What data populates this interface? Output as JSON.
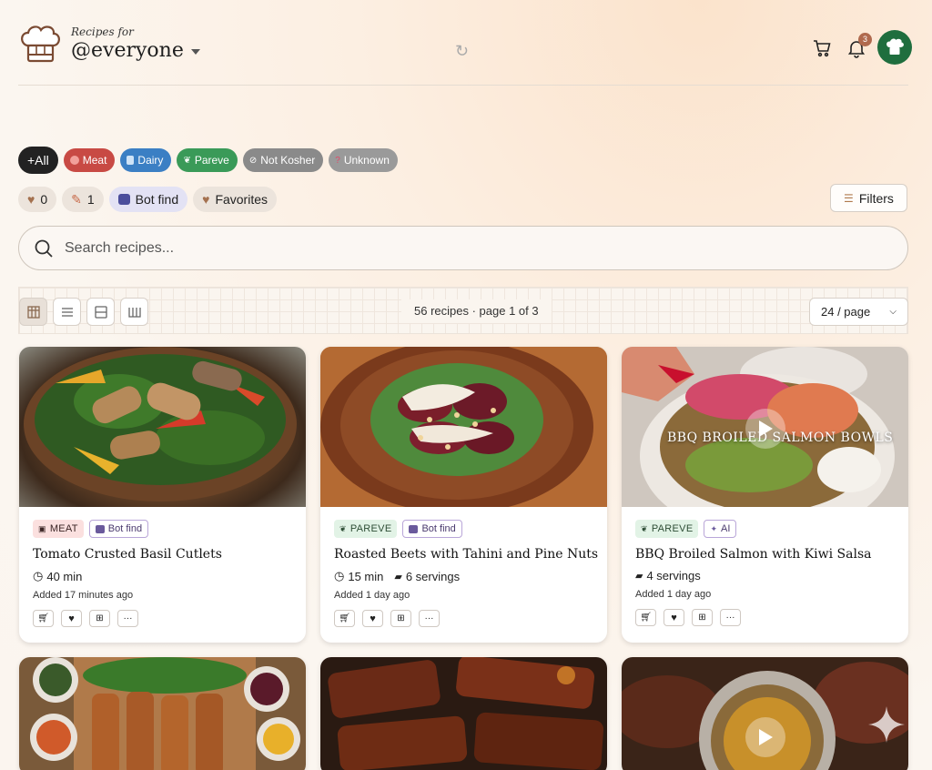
{
  "header": {
    "subtitle": "Recipes for",
    "title": "@everyone",
    "notification_count": "3",
    "icons": [
      "chef-hat-logo",
      "refresh-icon",
      "cart-icon",
      "bell-icon",
      "avatar-chef-icon"
    ]
  },
  "kosher_filters": [
    {
      "label": "+All",
      "color": "#222222"
    },
    {
      "label": "Meat",
      "color": "#c84a44"
    },
    {
      "label": "Dairy",
      "color": "#3b7fc4"
    },
    {
      "label": "Pareve",
      "color": "#3a9a58"
    },
    {
      "label": "Not Kosher",
      "color": "#8a8a8a"
    },
    {
      "label": "Unknown",
      "color": "#9a9a9a"
    }
  ],
  "quick_filters": {
    "likes_count": "0",
    "pins_count": "1",
    "bot_find": "Bot find",
    "favorites": "Favorites",
    "filters_button": "Filters"
  },
  "search": {
    "placeholder": "Search recipes..."
  },
  "toolbar": {
    "summary": "56 recipes · page 1 of 3",
    "per_page": "24 / page",
    "active_view": "grid"
  },
  "recipes": [
    {
      "tags": [
        {
          "label": "MEAT",
          "kind": "meat"
        },
        {
          "label": "Bot find",
          "kind": "bot"
        }
      ],
      "title": "Tomato Crusted Basil Cutlets",
      "time": "40 min",
      "servings": "",
      "added": "Added 17 minutes ago"
    },
    {
      "tags": [
        {
          "label": "PAREVE",
          "kind": "pareve"
        },
        {
          "label": "Bot find",
          "kind": "bot"
        }
      ],
      "title": "Roasted Beets with Tahini and Pine Nuts",
      "time": "15 min",
      "servings": "6 servings",
      "added": "Added 1 day ago"
    },
    {
      "tags": [
        {
          "label": "PAREVE",
          "kind": "pareve"
        },
        {
          "label": "AI",
          "kind": "ai"
        }
      ],
      "title": "BBQ Broiled Salmon with Kiwi Salsa",
      "time": "",
      "servings": "4 servings",
      "added": "Added 1 day ago",
      "video_overlay": "BBQ BROILED SALMON BOWLS"
    }
  ]
}
